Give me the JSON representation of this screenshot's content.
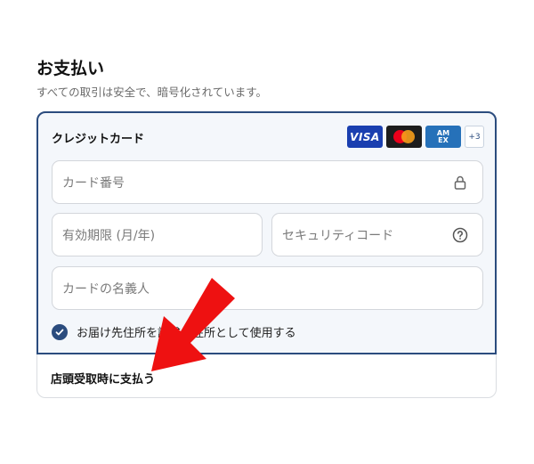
{
  "header": {
    "title": "お支払い",
    "subtitle": "すべての取引は安全で、暗号化されています。"
  },
  "payment": {
    "card_option_label": "クレジットカード",
    "brands": {
      "visa": "VISA",
      "amex_line1": "AM",
      "amex_line2": "EX",
      "more": "+3"
    },
    "fields": {
      "card_number_placeholder": "カード番号",
      "expiry_placeholder": "有効期限 (月/年)",
      "security_code_placeholder": "セキュリティコード",
      "name_placeholder": "カードの名義人"
    },
    "billing_checkbox": {
      "label": "お届け先住所を請求先住所として使用する",
      "checked": true
    },
    "store_option_label": "店頭受取時に支払う"
  },
  "colors": {
    "accent": "#2b4c7e",
    "annotation_arrow": "#ee1111"
  },
  "icons": [
    "lock-icon",
    "help-circle-icon",
    "check-icon",
    "red-arrow-annotation"
  ]
}
